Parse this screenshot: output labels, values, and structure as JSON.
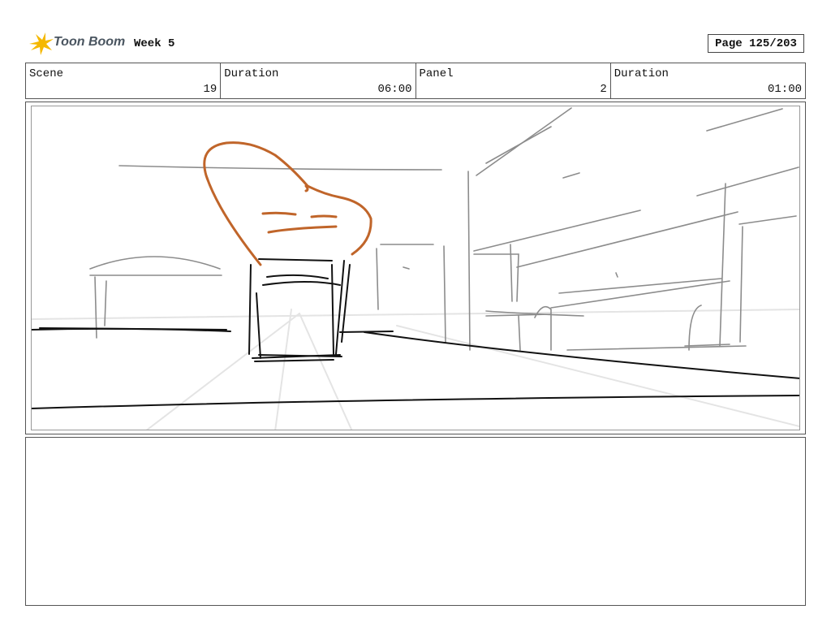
{
  "header": {
    "brand": "Toon Boom",
    "title": "Week 5",
    "page": "Page 125/203"
  },
  "info": {
    "scene_label": "Scene",
    "scene_value": "19",
    "scene_duration_label": "Duration",
    "scene_duration_value": "06:00",
    "panel_label": "Panel",
    "panel_value": "2",
    "panel_duration_label": "Duration",
    "panel_duration_value": "01:00"
  },
  "colors": {
    "sketch_gray": "#8c8c8c",
    "sketch_black": "#111111",
    "sketch_orange": "#c0652a",
    "logo_yellow": "#f5b800"
  },
  "notes": {
    "text": ""
  }
}
